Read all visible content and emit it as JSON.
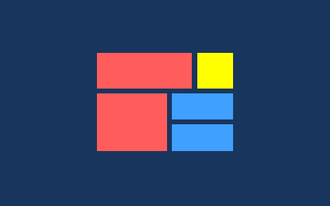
{
  "background_color": "#18355e",
  "logo": {
    "tiles": [
      {
        "name": "tile-top-left-wide",
        "color": "#ff5c5c"
      },
      {
        "name": "tile-top-right-square",
        "color": "#ffff00"
      },
      {
        "name": "tile-bottom-left-big",
        "color": "#ff5c5c"
      },
      {
        "name": "tile-mid-right-bar",
        "color": "#3fa0ff"
      },
      {
        "name": "tile-bottom-right-bar",
        "color": "#3fa0ff"
      }
    ]
  }
}
